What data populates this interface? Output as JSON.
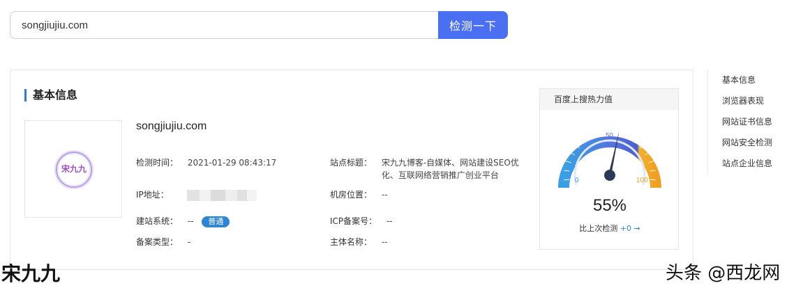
{
  "search": {
    "value": "songjiujiu.com",
    "button_label": "检测一下"
  },
  "basic_info": {
    "section_title": "基本信息",
    "logo_text": "宋九九",
    "domain": "songjiujiu.com",
    "fields": {
      "check_time_label": "检测时间：",
      "check_time_value": "2021-01-29 08:43:17",
      "site_title_label": "站点标题：",
      "site_title_value_line1": "宋九九博客-自媒体、网站建设SEO优",
      "site_title_value_line2": "化、互联网络营销推广创业平台",
      "ip_label": "IP地址：",
      "room_label": "机房位置：",
      "room_value": "--",
      "cms_label": "建站系统：",
      "cms_value": "--",
      "cms_badge": "普通",
      "icp_label": "ICP备案号：",
      "icp_value": "--",
      "record_type_label": "备案类型：",
      "record_type_value": "-",
      "subject_label": "主体名称：",
      "subject_value": "--"
    }
  },
  "heat": {
    "title": "百度上搜热力值",
    "percent": "55%",
    "percent_value": 55,
    "compare_label": "比上次检测",
    "compare_delta": "+0 ➞",
    "scale_min": "0",
    "scale_mid": "50",
    "scale_max": "100"
  },
  "side_nav": {
    "items": [
      "基本信息",
      "浏览器表现",
      "网站证书信息",
      "网站安全检测",
      "站点企业信息"
    ]
  },
  "watermark": {
    "left": "宋九九",
    "right": "头条 @西龙网"
  },
  "colors": {
    "primary_button": "#4a6ff0",
    "section_bar": "#2d7fc9",
    "badge": "#2d86d4"
  }
}
